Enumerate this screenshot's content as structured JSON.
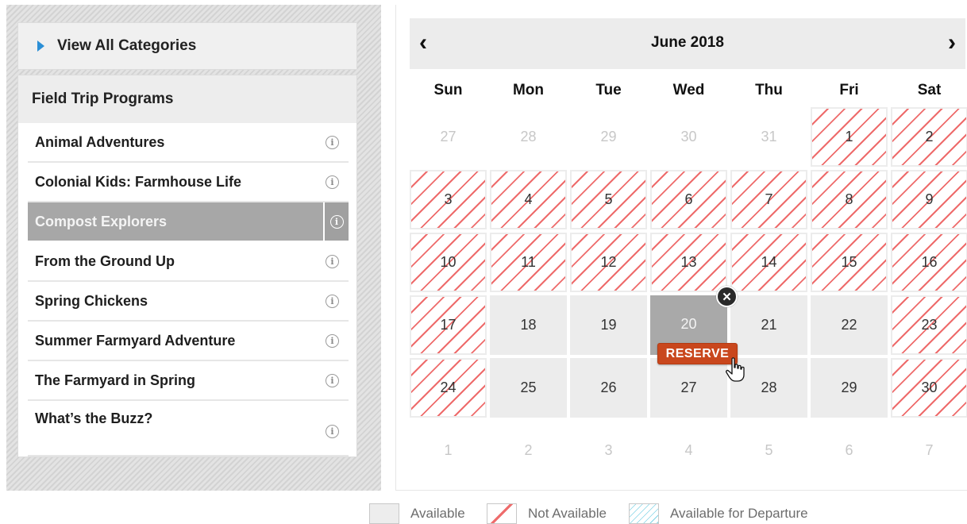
{
  "sidebar": {
    "view_all_label": "View All Categories",
    "section_title": "Field Trip Programs",
    "programs": [
      {
        "name": "Animal Adventures"
      },
      {
        "name": "Colonial Kids: Farmhouse Life"
      },
      {
        "name": "Compost Explorers"
      },
      {
        "name": "From the Ground Up"
      },
      {
        "name": "Spring Chickens"
      },
      {
        "name": "Summer Farmyard Adventure"
      },
      {
        "name": "The Farmyard in Spring"
      },
      {
        "name": "What’s the Buzz?"
      }
    ],
    "info_glyph": "i"
  },
  "calendar": {
    "month_title": "June 2018",
    "prev_glyph": "‹",
    "next_glyph": "›",
    "weekdays": [
      "Sun",
      "Mon",
      "Tue",
      "Wed",
      "Thu",
      "Fri",
      "Sat"
    ],
    "days": [
      {
        "label": "27",
        "state": "other"
      },
      {
        "label": "28",
        "state": "other"
      },
      {
        "label": "29",
        "state": "other"
      },
      {
        "label": "30",
        "state": "other"
      },
      {
        "label": "31",
        "state": "other"
      },
      {
        "label": "1",
        "state": "na"
      },
      {
        "label": "2",
        "state": "na"
      },
      {
        "label": "3",
        "state": "na"
      },
      {
        "label": "4",
        "state": "na"
      },
      {
        "label": "5",
        "state": "na"
      },
      {
        "label": "6",
        "state": "na"
      },
      {
        "label": "7",
        "state": "na"
      },
      {
        "label": "8",
        "state": "na"
      },
      {
        "label": "9",
        "state": "na"
      },
      {
        "label": "10",
        "state": "na"
      },
      {
        "label": "11",
        "state": "na"
      },
      {
        "label": "12",
        "state": "na"
      },
      {
        "label": "13",
        "state": "na"
      },
      {
        "label": "14",
        "state": "na"
      },
      {
        "label": "15",
        "state": "na"
      },
      {
        "label": "16",
        "state": "na"
      },
      {
        "label": "17",
        "state": "na"
      },
      {
        "label": "18",
        "state": "avail"
      },
      {
        "label": "19",
        "state": "avail"
      },
      {
        "label": "20",
        "state": "sel"
      },
      {
        "label": "21",
        "state": "avail"
      },
      {
        "label": "22",
        "state": "avail"
      },
      {
        "label": "23",
        "state": "na"
      },
      {
        "label": "24",
        "state": "na"
      },
      {
        "label": "25",
        "state": "avail"
      },
      {
        "label": "26",
        "state": "avail"
      },
      {
        "label": "27",
        "state": "avail"
      },
      {
        "label": "28",
        "state": "avail"
      },
      {
        "label": "29",
        "state": "avail"
      },
      {
        "label": "30",
        "state": "na"
      },
      {
        "label": "1",
        "state": "other"
      },
      {
        "label": "2",
        "state": "other"
      },
      {
        "label": "3",
        "state": "other"
      },
      {
        "label": "4",
        "state": "other"
      },
      {
        "label": "5",
        "state": "other"
      },
      {
        "label": "6",
        "state": "other"
      },
      {
        "label": "7",
        "state": "other"
      }
    ],
    "reserve_label": "RESERVE",
    "close_glyph": "✕"
  },
  "legend": {
    "available": "Available",
    "not_available": "Not Available",
    "available_for_departure": "Available for Departure"
  },
  "colors": {
    "accent_blue": "#2b8fd6",
    "reserve_orange": "#c9471d",
    "not_available_stripe": "#ee6b6b",
    "departure_stripe": "#7fd3e6"
  }
}
